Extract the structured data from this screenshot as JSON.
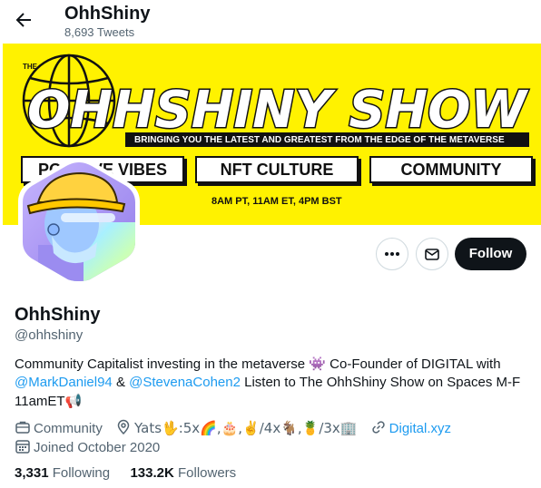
{
  "header": {
    "name": "OhhShiny",
    "tweet_count": "8,693 Tweets"
  },
  "banner": {
    "the": "THE",
    "show_title": "OHHSHINY SHOW",
    "tagline": "BRINGING YOU THE LATEST AND GREATEST FROM THE EDGE OF THE METAVERSE",
    "pills": [
      "POSITIVE VIBES",
      "NFT CULTURE",
      "COMMUNITY"
    ],
    "schedule": "8AM PT, 11AM ET, 4PM BST",
    "colors": {
      "background": "#fff200",
      "ink": "#111111"
    }
  },
  "actions": {
    "follow_label": "Follow"
  },
  "profile": {
    "name": "OhhShiny",
    "handle": "@ohhshiny",
    "bio": {
      "line1_text": "Community Capitalist investing in the metaverse ",
      "line1_emoji": "👾",
      "line1_text2": " Co-Founder of DIGITAL with",
      "mention1": "@MarkDaniel94",
      "amp": " & ",
      "mention2": "@StevenaCohen2",
      "line2_text": " Listen to The OhhShiny Show on Spaces M-F",
      "line3_text": "11amET",
      "line3_emoji": "📢"
    },
    "category": "Community",
    "location": "Yats🖖:5x🌈,🎂,✌️/4x🐐,🍍/3x🏢",
    "website": "Digital.xyz",
    "joined": "Joined October 2020"
  },
  "stats": {
    "following_count": "3,331",
    "following_label": "Following",
    "followers_count": "133.2K",
    "followers_label": "Followers"
  },
  "colors": {
    "accent": "#1d9bf0",
    "secondary_text": "#536471",
    "primary_text": "#0f1419"
  }
}
